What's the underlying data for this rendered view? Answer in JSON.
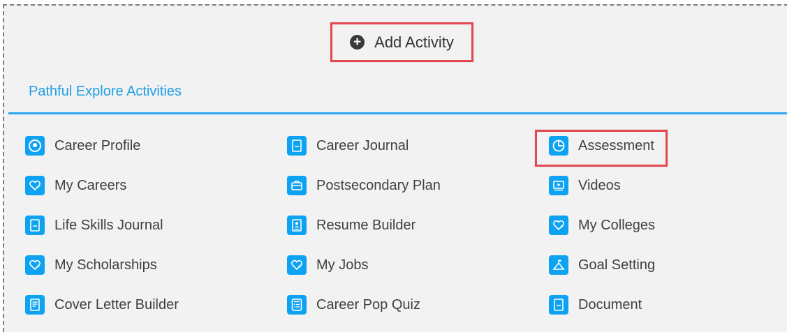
{
  "add_activity": {
    "label": "Add Activity",
    "icon": "plus-circle-icon"
  },
  "section": {
    "title": "Pathful Explore Activities"
  },
  "activities": [
    {
      "label": "Career Profile",
      "icon": "profile-icon"
    },
    {
      "label": "Career Journal",
      "icon": "journal-icon"
    },
    {
      "label": "Assessment",
      "icon": "pie-chart-icon"
    },
    {
      "label": "My Careers",
      "icon": "heart-plus-icon"
    },
    {
      "label": "Postsecondary Plan",
      "icon": "briefcase-icon"
    },
    {
      "label": "Videos",
      "icon": "video-icon"
    },
    {
      "label": "Life Skills Journal",
      "icon": "journal-icon"
    },
    {
      "label": "Resume Builder",
      "icon": "resume-icon"
    },
    {
      "label": "My Colleges",
      "icon": "heart-plus-icon"
    },
    {
      "label": "My Scholarships",
      "icon": "heart-plus-icon"
    },
    {
      "label": "My Jobs",
      "icon": "heart-plus-icon"
    },
    {
      "label": "Goal Setting",
      "icon": "mountain-flag-icon"
    },
    {
      "label": "Cover Letter Builder",
      "icon": "document-lines-icon"
    },
    {
      "label": "Career Pop Quiz",
      "icon": "quiz-icon"
    },
    {
      "label": "Document",
      "icon": "journal-icon"
    }
  ],
  "colors": {
    "accent": "#1f9ee6",
    "icon_bg": "#0ea3f2",
    "highlight": "#e4474f",
    "background": "#f2f2f2"
  }
}
